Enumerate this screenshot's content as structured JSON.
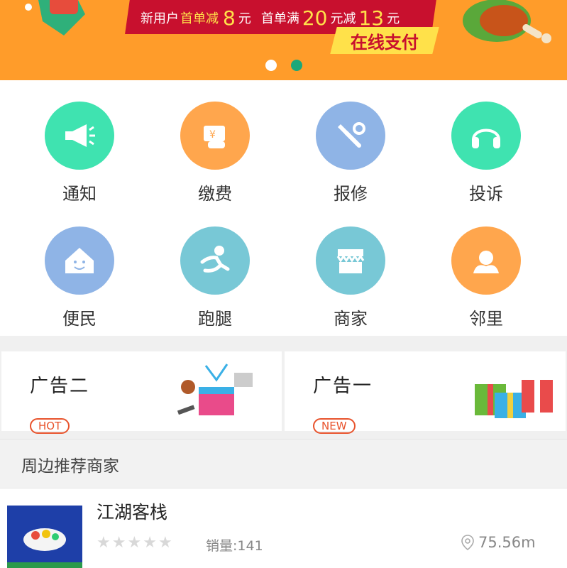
{
  "banner": {
    "promo_prefix": "新用户",
    "promo_first": "首单减",
    "promo_amount1": "8",
    "promo_unit1": "元",
    "promo_second": "首单满",
    "promo_threshold": "20",
    "promo_unit_mid": "元减",
    "promo_amount2": "13",
    "promo_unit2": "元",
    "pay_label": "在线支付",
    "slides_total": 2,
    "active_slide": 2
  },
  "grid": {
    "items": [
      {
        "label": "通知",
        "icon": "megaphone-icon",
        "color": "#3fe3b0"
      },
      {
        "label": "缴费",
        "icon": "payment-icon",
        "color": "#ffa64d"
      },
      {
        "label": "报修",
        "icon": "repair-icon",
        "color": "#8fb4e6"
      },
      {
        "label": "投诉",
        "icon": "headphones-icon",
        "color": "#3fe3b0"
      },
      {
        "label": "便民",
        "icon": "house-icon",
        "color": "#8fb4e6"
      },
      {
        "label": "跑腿",
        "icon": "runner-icon",
        "color": "#78c8d6"
      },
      {
        "label": "商家",
        "icon": "store-icon",
        "color": "#78c8d6"
      },
      {
        "label": "邻里",
        "icon": "neighbor-icon",
        "color": "#ffa64d"
      }
    ]
  },
  "ads": {
    "left": {
      "title": "广告二",
      "badge": "HOT"
    },
    "right": {
      "title": "广告一",
      "badge": "NEW"
    }
  },
  "section": {
    "title": "周边推荐商家"
  },
  "shops": [
    {
      "name": "江湖客栈",
      "rating": 0,
      "sales": "销量:141",
      "distance": "75.56m"
    }
  ],
  "colors": {
    "accent": "#ff9c2a",
    "badge": "#e8532c",
    "dot_active": "#1aa87a"
  }
}
